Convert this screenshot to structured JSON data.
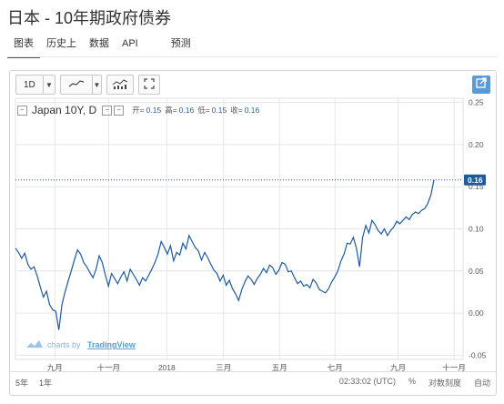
{
  "page": {
    "title": "日本 - 10年期政府债券",
    "tabs": [
      "图表",
      "历史上",
      "数据",
      "API",
      "预测"
    ]
  },
  "toolbar": {
    "interval": "1D",
    "line_icon": "line-chart-icon",
    "bars_icon": "bars-chart-icon",
    "fullscreen_icon": "fullscreen-icon",
    "popout_icon": "popout-icon"
  },
  "legend": {
    "symbol": "Japan 10Y, D",
    "open_label": "开=",
    "open_value": "0.15",
    "high_label": "高=",
    "high_value": "0.16",
    "low_label": "低=",
    "low_value": "0.15",
    "close_label": "收=",
    "close_value": "0.16"
  },
  "watermark": {
    "prefix": "charts by",
    "brand": "TradingView"
  },
  "footer": {
    "periods": [
      "5年",
      "1年"
    ],
    "time": "02:33:02 (UTC)",
    "percent": "%",
    "log_scale": "对数刻度",
    "auto": "自动"
  },
  "colors": {
    "line": "#1e5a9e",
    "price_tag": "#1e5a9e",
    "grid": "#e6e6e6",
    "popout": "#5b9bd5"
  },
  "chart_data": {
    "type": "line",
    "series": [
      {
        "values": [
          0.077,
          0.072,
          0.065,
          0.071,
          0.058,
          0.052,
          0.055,
          0.044,
          0.031,
          0.019,
          0.026,
          0.01,
          0.004,
          0.002,
          -0.02,
          0.01,
          0.025,
          0.038,
          0.05,
          0.063,
          0.075,
          0.07,
          0.06,
          0.055,
          0.048,
          0.042,
          0.052,
          0.068,
          0.06,
          0.045,
          0.032,
          0.047,
          0.041,
          0.035,
          0.043,
          0.049,
          0.038,
          0.052,
          0.046,
          0.04,
          0.033,
          0.042,
          0.038,
          0.045,
          0.052,
          0.06,
          0.07,
          0.085,
          0.078,
          0.07,
          0.08,
          0.062,
          0.072,
          0.069,
          0.083,
          0.076,
          0.092,
          0.085,
          0.078,
          0.074,
          0.063,
          0.072,
          0.066,
          0.058,
          0.051,
          0.047,
          0.038,
          0.045,
          0.033,
          0.039,
          0.029,
          0.023,
          0.015,
          0.028,
          0.037,
          0.044,
          0.04,
          0.034,
          0.041,
          0.046,
          0.053,
          0.048,
          0.057,
          0.054,
          0.046,
          0.051,
          0.06,
          0.058,
          0.049,
          0.05,
          0.042,
          0.035,
          0.038,
          0.032,
          0.034,
          0.03,
          0.04,
          0.036,
          0.028,
          0.026,
          0.024,
          0.029,
          0.037,
          0.043,
          0.05,
          0.062,
          0.07,
          0.083,
          0.082,
          0.09,
          0.077,
          0.055,
          0.09,
          0.104,
          0.095,
          0.11,
          0.105,
          0.098,
          0.094,
          0.1,
          0.092,
          0.098,
          0.102,
          0.109,
          0.106,
          0.11,
          0.114,
          0.111,
          0.117,
          0.12,
          0.118,
          0.122,
          0.124,
          0.13,
          0.14,
          0.158
        ]
      }
    ],
    "x_tick_labels": [
      "九月",
      "十一月",
      "2018",
      "三月",
      "五月",
      "七月",
      "九月",
      "十一月"
    ],
    "y_ticks": [
      -0.05,
      0.0,
      0.05,
      0.1,
      0.15,
      0.2,
      0.25
    ],
    "ylim": [
      -0.055,
      0.255
    ],
    "last_value": "0.16"
  }
}
